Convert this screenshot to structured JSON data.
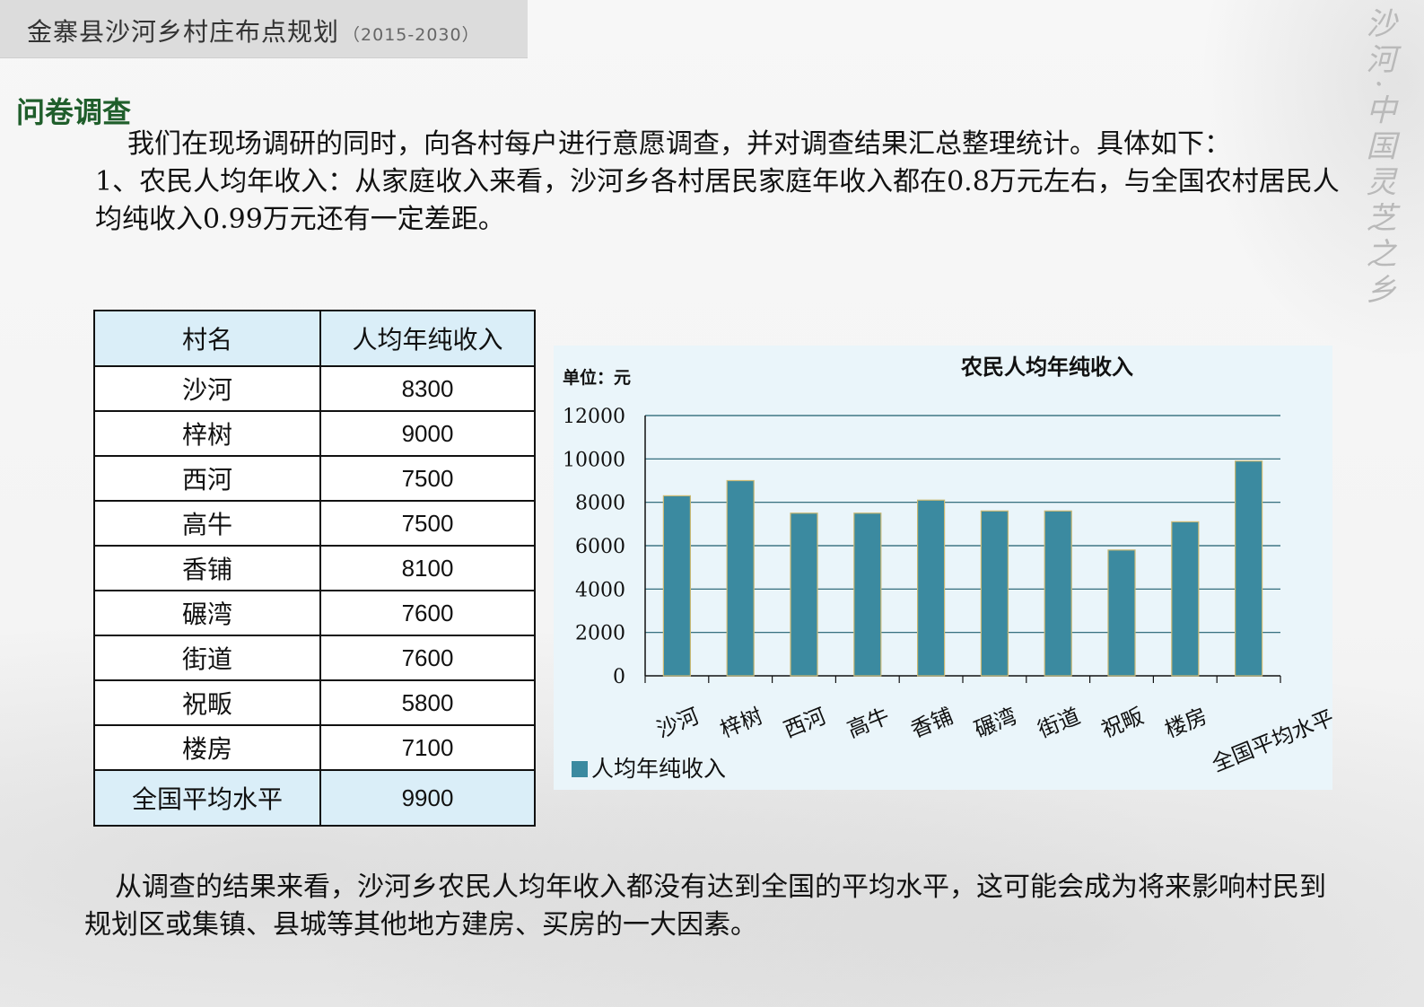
{
  "header": {
    "title": "金寨县沙河乡村庄布点规划",
    "years": "（2015-2030）"
  },
  "slogan": "沙河·中国灵芝之乡",
  "section_title": "问卷调查",
  "intro": {
    "line1": "我们在现场调研的同时，向各村每户进行意愿调查，并对调查结果汇总整理统计。具体如下：",
    "line2": "1、农民人均年收入：从家庭收入来看，沙河乡各村居民家庭年收入都在0.8万元左右，与全国农村居民人均纯收入0.99万元还有一定差距。"
  },
  "table": {
    "headers": [
      "村名",
      "人均年纯收入"
    ],
    "rows": [
      {
        "name": "沙河",
        "value": "8300"
      },
      {
        "name": "梓树",
        "value": "9000"
      },
      {
        "name": "西河",
        "value": "7500"
      },
      {
        "name": "高牛",
        "value": "7500"
      },
      {
        "name": "香铺",
        "value": "8100"
      },
      {
        "name": "碾湾",
        "value": "7600"
      },
      {
        "name": "街道",
        "value": "7600"
      },
      {
        "name": "祝畈",
        "value": "5800"
      },
      {
        "name": "楼房",
        "value": "7100"
      }
    ],
    "average": {
      "name": "全国平均水平",
      "value": "9900"
    }
  },
  "chart_data": {
    "type": "bar",
    "title": "农民人均年纯收入",
    "unit_label": "单位：元",
    "categories": [
      "沙河",
      "梓树",
      "西河",
      "高牛",
      "香铺",
      "碾湾",
      "街道",
      "祝畈",
      "楼房",
      "全国平均水平"
    ],
    "series": [
      {
        "name": "人均年纯收入",
        "values": [
          8300,
          9000,
          7500,
          7500,
          8100,
          7600,
          7600,
          5800,
          7100,
          9900
        ]
      }
    ],
    "ylim": [
      0,
      12000
    ],
    "yticks": [
      0,
      2000,
      4000,
      6000,
      8000,
      10000,
      12000
    ],
    "grid": true,
    "legend_position": "bottom-left",
    "colors": {
      "bar": "#3b8aa0",
      "bar_edge": "#c8b873",
      "grid": "#1f5e6e",
      "background": "#eaf5fa"
    }
  },
  "conclusion": {
    "line1": "从调查的结果来看，沙河乡农民人均年收入都没有达到全国的平均水平，这可能会成为将来影响村民到规划区或集镇、县城等其他地方建房、买房的一大因素。"
  }
}
